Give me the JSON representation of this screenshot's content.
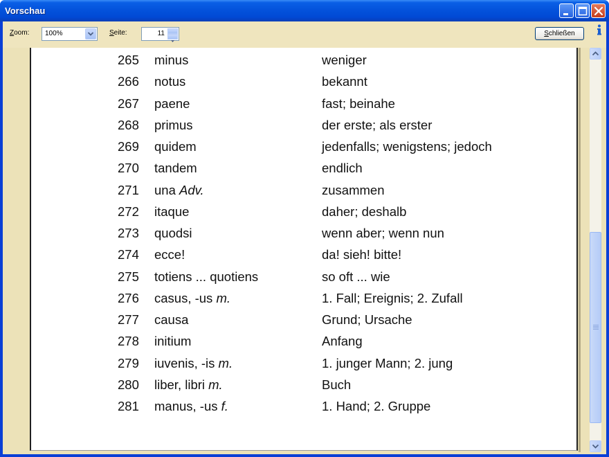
{
  "window": {
    "title": "Vorschau"
  },
  "toolbar": {
    "zoom_label_first": "Z",
    "zoom_label_rest": "oom:",
    "zoom_value": "100%",
    "page_label_first": "S",
    "page_label_rest": "eite:",
    "page_value": "11",
    "close_label_first": "S",
    "close_label_rest": "chließen",
    "info_icon": "info-icon"
  },
  "colors": {
    "titlebar": "#0453dc",
    "client_background": "#ece2b8",
    "paper": "#ffffff"
  },
  "vocabulary": [
    {
      "num": "265",
      "latin": "minus",
      "latin_note": "",
      "german": "weniger"
    },
    {
      "num": "266",
      "latin": "notus",
      "latin_note": "",
      "german": "bekannt"
    },
    {
      "num": "267",
      "latin": "paene",
      "latin_note": "",
      "german": "fast; beinahe"
    },
    {
      "num": "268",
      "latin": "primus",
      "latin_note": "",
      "german": "der erste; als erster"
    },
    {
      "num": "269",
      "latin": "quidem",
      "latin_note": "",
      "german": "jedenfalls; wenigstens; jedoch"
    },
    {
      "num": "270",
      "latin": "tandem",
      "latin_note": "",
      "german": "endlich"
    },
    {
      "num": "271",
      "latin": "una ",
      "latin_note": "Adv.",
      "german": "zusammen"
    },
    {
      "num": "272",
      "latin": "itaque",
      "latin_note": "",
      "german": "daher; deshalb"
    },
    {
      "num": "273",
      "latin": "quodsi",
      "latin_note": "",
      "german": "wenn aber; wenn nun"
    },
    {
      "num": "274",
      "latin": "ecce!",
      "latin_note": "",
      "german": "da! sieh! bitte!"
    },
    {
      "num": "275",
      "latin": "totiens ... quotiens",
      "latin_note": "",
      "german": "so oft ... wie"
    },
    {
      "num": "276",
      "latin": "casus, -us ",
      "latin_note": "m.",
      "german": "1. Fall; Ereignis; 2. Zufall"
    },
    {
      "num": "277",
      "latin": "causa",
      "latin_note": "",
      "german": "Grund; Ursache"
    },
    {
      "num": "278",
      "latin": "initium",
      "latin_note": "",
      "german": "Anfang"
    },
    {
      "num": "279",
      "latin": "iuvenis, -is ",
      "latin_note": "m.",
      "german": "1. junger Mann; 2. jung"
    },
    {
      "num": "280",
      "latin": "liber, libri ",
      "latin_note": "m.",
      "german": "Buch"
    },
    {
      "num": "281",
      "latin": "manus, -us ",
      "latin_note": "f.",
      "german": "1. Hand; 2. Gruppe"
    }
  ]
}
